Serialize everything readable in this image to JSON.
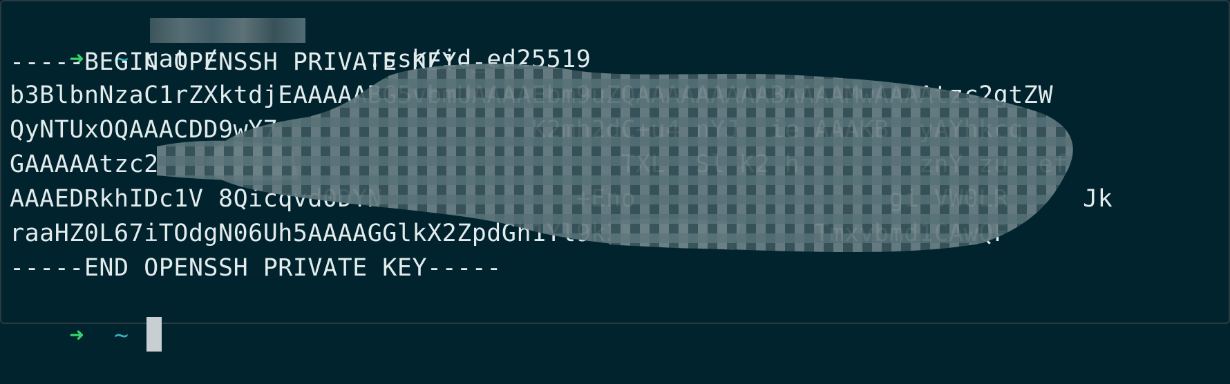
{
  "prompt": {
    "arrow": "➜",
    "tilde": "~"
  },
  "command": {
    "text": "cat /          .ssh/id_ed25519"
  },
  "output": {
    "lines": [
      "-----BEGIN OPENSSH PRIVATE KEY-----",
      "b3BlbnNzaC1rZXktdjEAAAAABG5vbmUAAAAEbm9uZQAAAAAAAAABAAAAMwAAAAtzc2gtZW",
      "QyNTUxOQAAACDD9wY7                 K2mh2dC+u4 nYJ  ie AAAKB  yAYhkcq",
      "GAAAAAtzc2                               TXL  Sl K2 h        znY zu  ef",
      "AAAEDRkhIDc1V 8Qicqvd0DYN             +Eno                 gi VW0LR     Jk",
      "raaHZ0L67iTOdgN06Uh5AAAAGGlkX2ZpdGh1Yl9kZX            Tmxvbmd1CAwQF",
      "-----END OPENSSH PRIVATE KEY-----"
    ]
  },
  "colors": {
    "background": "#00232d",
    "text": "#e3ebec",
    "arrow": "#38d36a",
    "tilde": "#39b2c3",
    "redaction": "#4f6a70"
  }
}
